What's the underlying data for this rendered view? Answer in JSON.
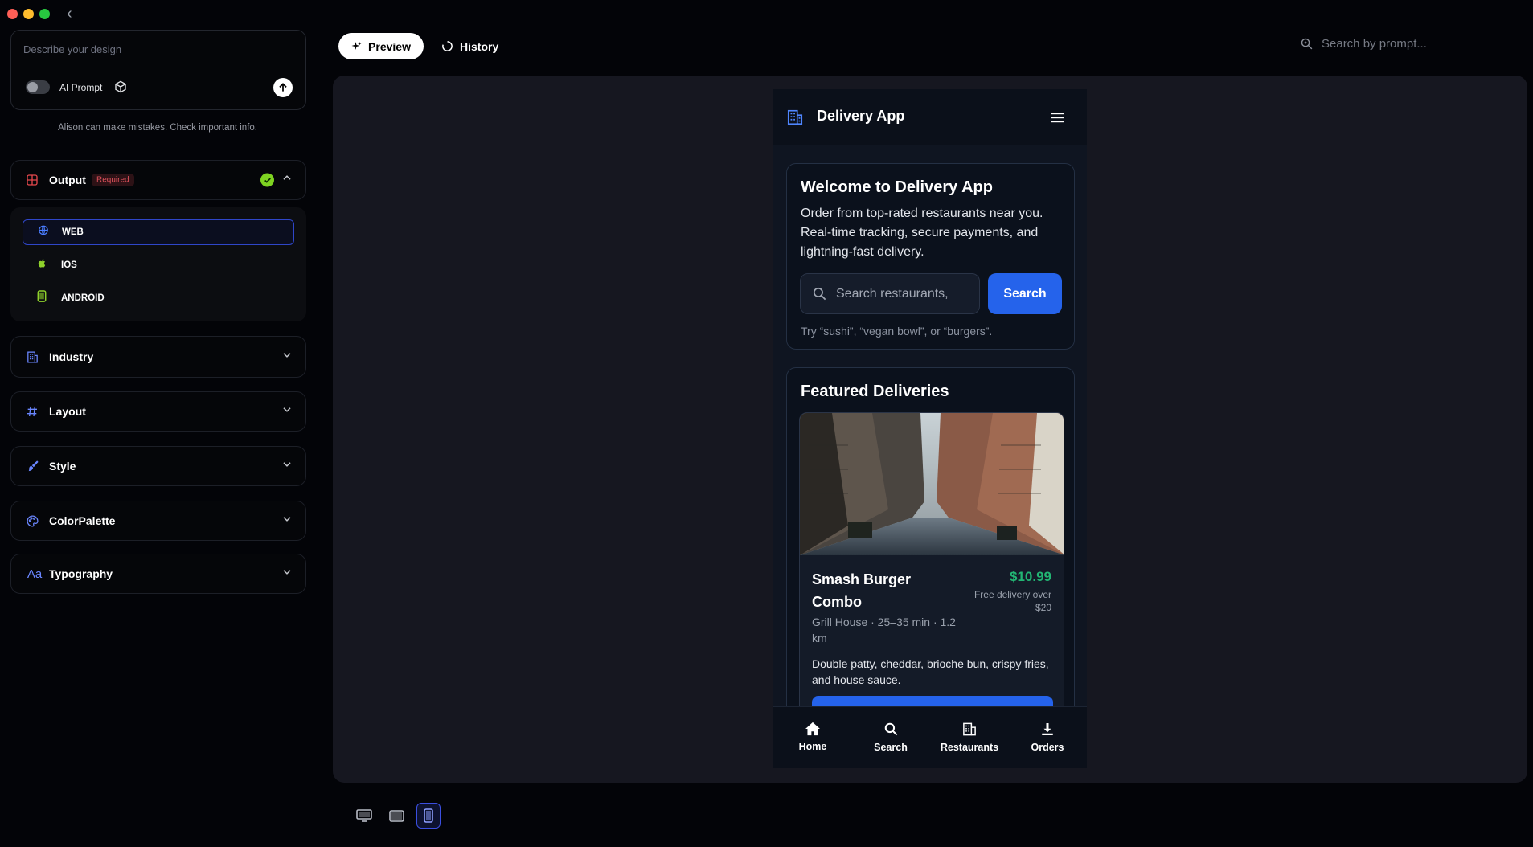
{
  "window": {
    "back_label": "‹"
  },
  "sidebar": {
    "prompt_placeholder": "Describe your design",
    "ai_prompt_label": "AI Prompt",
    "disclaimer": "Alison can make mistakes. Check important info.",
    "sections": {
      "output": {
        "title": "Output",
        "badge": "Required"
      },
      "industry": {
        "title": "Industry"
      },
      "layout": {
        "title": "Layout"
      },
      "style": {
        "title": "Style"
      },
      "color_palette": {
        "title": "ColorPalette"
      },
      "typography": {
        "title": "Typography"
      }
    },
    "output_options": [
      {
        "label": "WEB",
        "selected": true
      },
      {
        "label": "IOS",
        "selected": false
      },
      {
        "label": "ANDROID",
        "selected": false
      }
    ]
  },
  "topbar": {
    "preview_label": "Preview",
    "history_label": "History",
    "search_placeholder": "Search by prompt..."
  },
  "phone": {
    "brand": "Delivery App",
    "welcome": {
      "title": "Welcome to Delivery App",
      "body": "Order from top-rated restaurants near you. Real-time tracking, secure payments, and lightning-fast delivery.",
      "search_placeholder": "Search restaurants,",
      "search_button": "Search",
      "hint": "Try “sushi”, “vegan bowl”, or “burgers”."
    },
    "featured": {
      "title": "Featured Deliveries",
      "item": {
        "name": "Smash Burger Combo",
        "price": "$10.99",
        "free_delivery": "Free delivery over $20",
        "meta": "Grill House · 25–35 min · 1.2 km",
        "description": "Double patty, cheddar, brioche bun, crispy fries, and house sauce."
      }
    },
    "nav": [
      {
        "label": "Home",
        "icon": "home-icon"
      },
      {
        "label": "Search",
        "icon": "search-icon"
      },
      {
        "label": "Restaurants",
        "icon": "building-icon"
      },
      {
        "label": "Orders",
        "icon": "download-icon"
      }
    ]
  },
  "devices": [
    {
      "icon": "desktop-icon",
      "selected": false
    },
    {
      "icon": "tablet-icon",
      "selected": false
    },
    {
      "icon": "mobile-icon",
      "selected": true
    }
  ],
  "colors": {
    "accent": "#2563eb",
    "price": "#22b573",
    "required": "#e0525c",
    "check": "#7ed321"
  }
}
